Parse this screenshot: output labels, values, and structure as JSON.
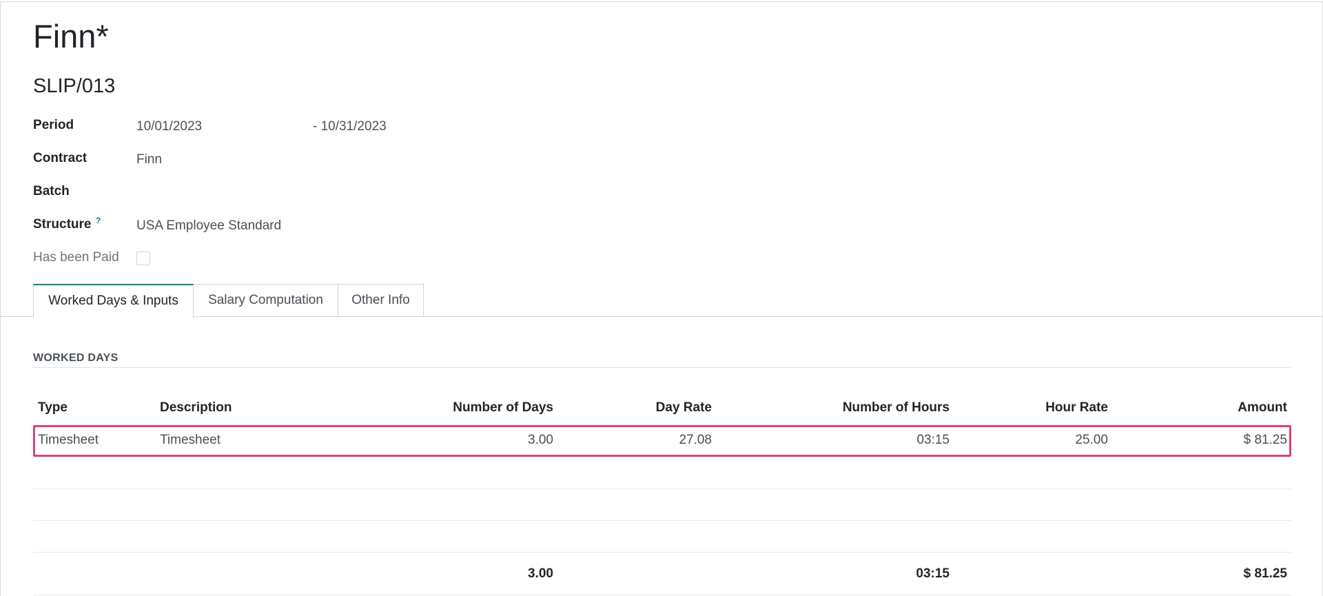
{
  "record": {
    "title": "Finn*",
    "reference": "SLIP/013"
  },
  "fields": {
    "period_label": "Period",
    "period_start": "10/01/2023",
    "period_end": "- 10/31/2023",
    "contract_label": "Contract",
    "contract_value": "Finn",
    "batch_label": "Batch",
    "batch_value": "",
    "structure_label": "Structure",
    "structure_help": "?",
    "structure_value": "USA Employee Standard",
    "paid_label": "Has been Paid",
    "paid_value": false
  },
  "tabs": [
    {
      "label": "Worked Days & Inputs",
      "active": true
    },
    {
      "label": "Salary Computation",
      "active": false
    },
    {
      "label": "Other Info",
      "active": false
    }
  ],
  "worked_days": {
    "section_title": "WORKED DAYS",
    "columns": [
      "Type",
      "Description",
      "Number of Days",
      "Day Rate",
      "Number of Hours",
      "Hour Rate",
      "Amount"
    ],
    "rows": [
      {
        "type": "Timesheet",
        "description": "Timesheet",
        "days": "3.00",
        "day_rate": "27.08",
        "hours": "03:15",
        "hour_rate": "25.00",
        "amount": "$ 81.25"
      }
    ],
    "totals": {
      "days": "3.00",
      "hours": "03:15",
      "amount": "$ 81.25"
    }
  },
  "colors": {
    "accent": "#017e84",
    "highlight": "#d9417a"
  }
}
